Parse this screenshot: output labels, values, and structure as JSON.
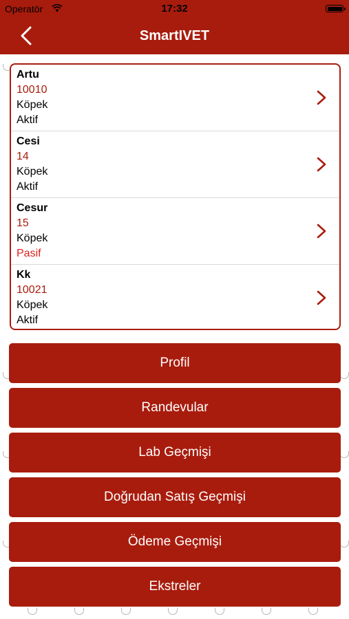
{
  "status_bar": {
    "carrier": "Operatör",
    "time": "17:32"
  },
  "nav": {
    "title": "SmartIVET",
    "back_icon": "chevron-left-icon"
  },
  "pets": [
    {
      "name": "Artu",
      "id": "10010",
      "species": "Köpek",
      "status": "Aktif",
      "passive": false
    },
    {
      "name": "Cesi",
      "id": "14",
      "species": "Köpek",
      "status": "Aktif",
      "passive": false
    },
    {
      "name": "Cesur",
      "id": "15",
      "species": "Köpek",
      "status": "Pasif",
      "passive": true
    },
    {
      "name": "Kk",
      "id": "10021",
      "species": "Köpek",
      "status": "Aktif",
      "passive": false
    }
  ],
  "menu": [
    {
      "label": "Profil"
    },
    {
      "label": "Randevular"
    },
    {
      "label": "Lab Geçmişi"
    },
    {
      "label": "Doğrudan Satış Geçmişi"
    },
    {
      "label": "Ödeme Geçmişi"
    },
    {
      "label": "Ekstreler"
    }
  ],
  "colors": {
    "brand": "#a81c0d",
    "passive": "#e02020"
  }
}
